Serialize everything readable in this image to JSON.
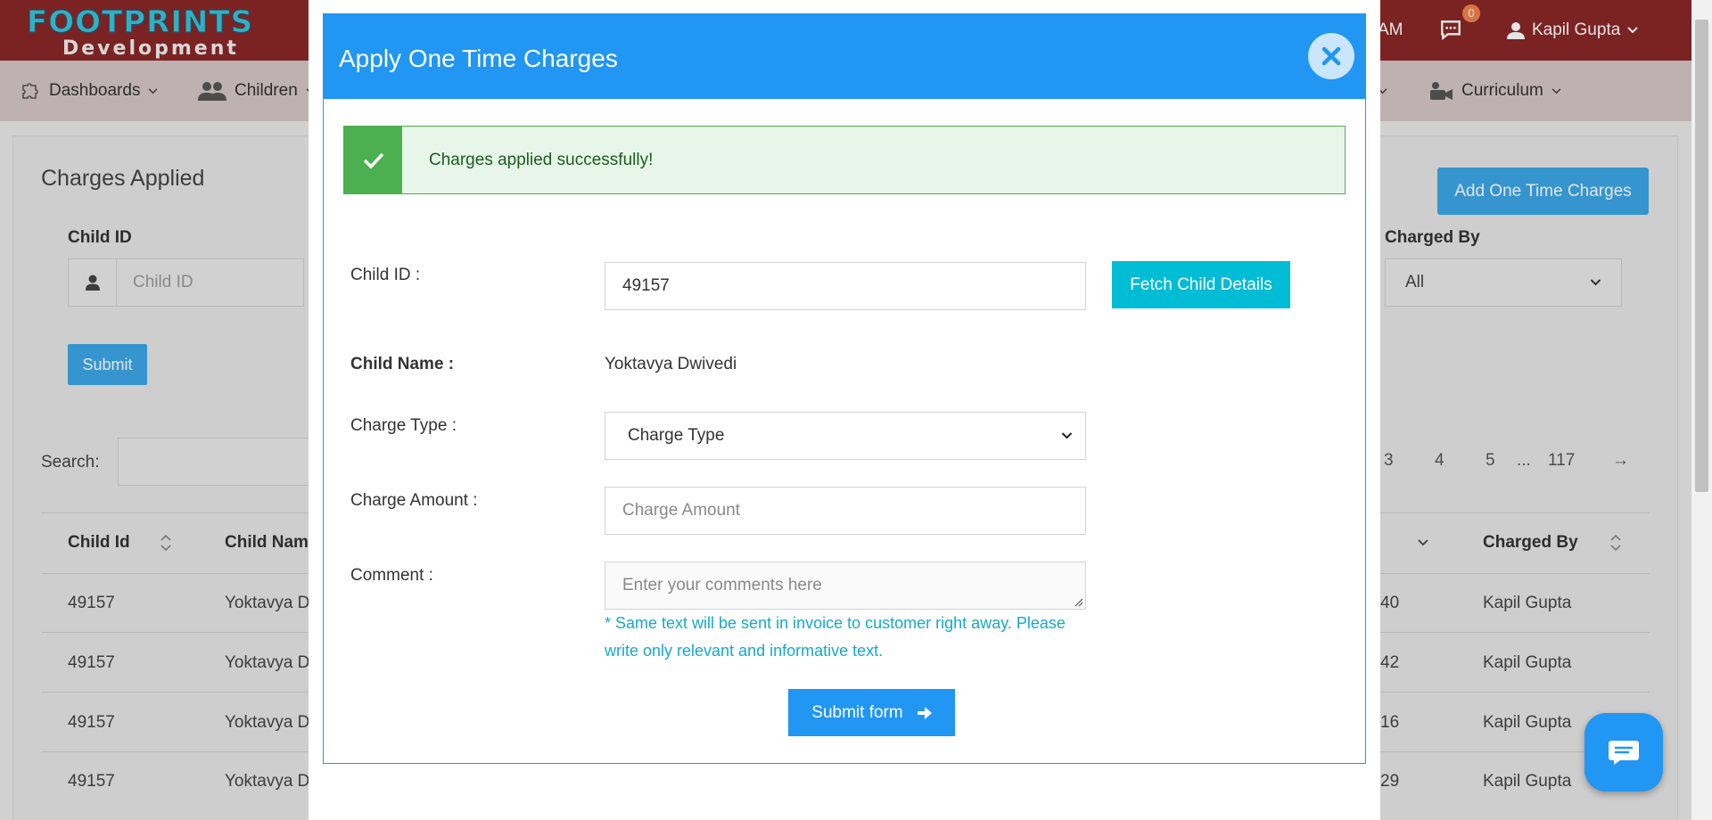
{
  "topbar": {
    "logo_line1": "FOOTPRINTS",
    "logo_line2": "Development",
    "time_fragment": "AM",
    "messages_count": "0",
    "user_name": "Kapil Gupta"
  },
  "nav": {
    "items": [
      {
        "label": "Dashboards",
        "icon": "puzzle-icon"
      },
      {
        "label": "Children",
        "icon": "users-icon"
      },
      {
        "label": "Curriculum",
        "icon": "video-person-icon"
      }
    ]
  },
  "page": {
    "title": "Charges Applied",
    "child_id_label": "Child ID",
    "child_id_placeholder": "Child ID",
    "submit_label": "Submit",
    "add_button": "Add One Time Charges",
    "charged_by_label": "Charged By",
    "charged_by_value": "All",
    "search_label": "Search:",
    "pagination": [
      "3",
      "4",
      "5",
      "...",
      "117",
      "→"
    ],
    "columns": [
      "Child Id",
      "Child Name",
      "Charged By"
    ],
    "rows": [
      {
        "child_id": "49157",
        "child_name": "Yoktavya D",
        "partial": "40",
        "charged_by": "Kapil Gupta"
      },
      {
        "child_id": "49157",
        "child_name": "Yoktavya D",
        "partial": "42",
        "charged_by": "Kapil Gupta"
      },
      {
        "child_id": "49157",
        "child_name": "Yoktavya D",
        "partial": "16",
        "charged_by": "Kapil Gupta"
      },
      {
        "child_id": "49157",
        "child_name": "Yoktavya D",
        "partial": "29",
        "charged_by": "Kapil Gupta"
      }
    ]
  },
  "modal": {
    "title": "Apply One Time Charges",
    "alert": "Charges applied successfully!",
    "child_id_label": "Child ID :",
    "child_id_value": "49157",
    "fetch_button": "Fetch Child Details",
    "child_name_label": "Child Name :",
    "child_name_value": "Yoktavya Dwivedi",
    "charge_type_label": "Charge Type :",
    "charge_type_value": "Charge Type",
    "charge_amount_label": "Charge Amount :",
    "charge_amount_placeholder": "Charge Amount",
    "comment_label": "Comment :",
    "comment_placeholder": "Enter your comments here",
    "note_line1": "* Same text will be sent in invoice to customer right away. Please",
    "note_line2": "write only relevant and informative text.",
    "submit_button": "Submit form"
  },
  "colors": {
    "topbar": "#8a2727",
    "primary": "#2196f3",
    "success": "#4caf50",
    "fetch": "#00bcd4"
  }
}
